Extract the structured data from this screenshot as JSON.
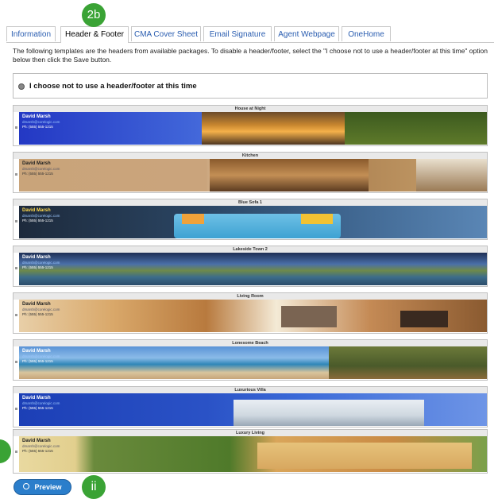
{
  "tabs": [
    {
      "label": "Information"
    },
    {
      "label": "Header & Footer"
    },
    {
      "label": "CMA Cover Sheet"
    },
    {
      "label": "Email Signature"
    },
    {
      "label": "Agent Webpage"
    },
    {
      "label": "OneHome"
    }
  ],
  "active_tab": "Header & Footer",
  "badges": {
    "top": "2b",
    "bottom": "ii"
  },
  "intro_text": "The following templates are the headers from available packages. To disable a header/footer, select the \"I choose not to use a header/footer at this time\" option below then click the Save button.",
  "optout_label": "I choose not to use a header/footer at this time",
  "agent": {
    "name": "David Marsh",
    "email": "dmarsh@corelogic.com",
    "phone": "Ph: (555) 555-1215"
  },
  "templates": [
    {
      "title": "House at Night"
    },
    {
      "title": "Kitchen"
    },
    {
      "title": "Blue Sofa 1"
    },
    {
      "title": "Lakeside Town 2"
    },
    {
      "title": "Living Room"
    },
    {
      "title": "Lonesome Beach"
    },
    {
      "title": "Luxurious Villa"
    },
    {
      "title": "Luxury Living"
    }
  ],
  "preview_label": "Preview",
  "colors": {
    "accent": "#2b7ecb",
    "badge": "#3aa335",
    "tab_link": "#2a5db0"
  }
}
